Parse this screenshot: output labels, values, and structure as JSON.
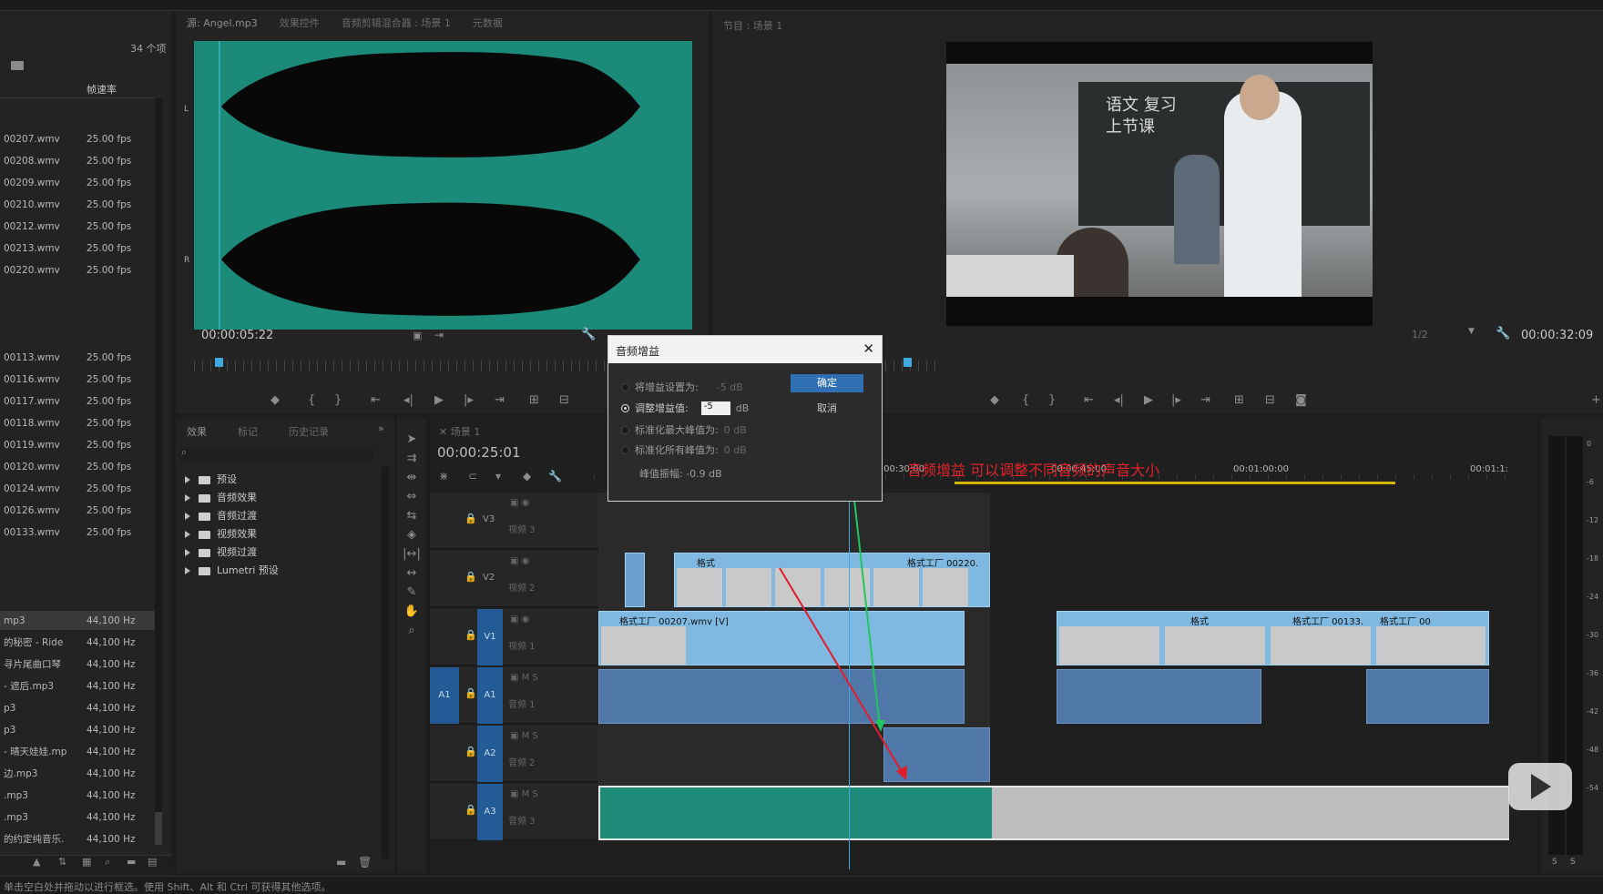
{
  "project": {
    "count": "34 个项",
    "col_header": "帧速率",
    "video_rows": [
      {
        "name": "00207.wmv",
        "rate": "25.00 fps"
      },
      {
        "name": "00208.wmv",
        "rate": "25.00 fps"
      },
      {
        "name": "00209.wmv",
        "rate": "25.00 fps"
      },
      {
        "name": "00210.wmv",
        "rate": "25.00 fps"
      },
      {
        "name": "00212.wmv",
        "rate": "25.00 fps"
      },
      {
        "name": "00213.wmv",
        "rate": "25.00 fps"
      },
      {
        "name": "00220.wmv",
        "rate": "25.00 fps"
      },
      {
        "name": "00113.wmv",
        "rate": "25.00 fps"
      },
      {
        "name": "00116.wmv",
        "rate": "25.00 fps"
      },
      {
        "name": "00117.wmv",
        "rate": "25.00 fps"
      },
      {
        "name": "00118.wmv",
        "rate": "25.00 fps"
      },
      {
        "name": "00119.wmv",
        "rate": "25.00 fps"
      },
      {
        "name": "00120.wmv",
        "rate": "25.00 fps"
      },
      {
        "name": "00124.wmv",
        "rate": "25.00 fps"
      },
      {
        "name": "00126.wmv",
        "rate": "25.00 fps"
      },
      {
        "name": "00133.wmv",
        "rate": "25.00 fps"
      }
    ],
    "audio_rows": [
      {
        "name": "mp3",
        "rate": "44,100 Hz"
      },
      {
        "name": "的秘密 - Ride",
        "rate": "44,100 Hz"
      },
      {
        "name": "寻片尾曲口琴",
        "rate": "44,100 Hz"
      },
      {
        "name": "- 遮后.mp3",
        "rate": "44,100 Hz"
      },
      {
        "name": "p3",
        "rate": "44,100 Hz"
      },
      {
        "name": "p3",
        "rate": "44,100 Hz"
      },
      {
        "name": "- 晴天娃娃.mp",
        "rate": "44,100 Hz"
      },
      {
        "name": "边.mp3",
        "rate": "44,100 Hz"
      },
      {
        "name": ".mp3",
        "rate": "44,100 Hz"
      },
      {
        "name": ".mp3",
        "rate": "44,100 Hz"
      },
      {
        "name": "的约定纯音乐.",
        "rate": "44,100 Hz"
      }
    ]
  },
  "source_monitor": {
    "tabs": [
      "源: Angel.mp3",
      "效果控件",
      "音频剪辑混合器 : 场景 1",
      "元数据"
    ],
    "timecode": "00:00:05:22",
    "channel_labels": [
      "L",
      "R"
    ]
  },
  "program_monitor": {
    "tab": "节目 : 场景 1",
    "timecode": "00:00:32:09",
    "zoom": "1/2",
    "frame_text": "语文 复习上节课"
  },
  "effects": {
    "tabs": [
      "效果",
      "标记",
      "历史记录"
    ],
    "items": [
      "预设",
      "音频效果",
      "音频过渡",
      "视频效果",
      "视频过渡",
      "Lumetri 预设"
    ]
  },
  "timeline": {
    "tab": "场景 1",
    "timecode": "00:00:25:01",
    "ruler": [
      "00:00:30:00",
      "00:00:45:00",
      "00:01:00:00",
      "00:01:1:"
    ],
    "tracks": [
      {
        "id": "V3",
        "name": "视频 3"
      },
      {
        "id": "V2",
        "name": "视频 2"
      },
      {
        "id": "V1",
        "name": "视频 1"
      },
      {
        "id": "A1",
        "name": "音频 1"
      },
      {
        "id": "A2",
        "name": "音频 2"
      },
      {
        "id": "A3",
        "name": "音频 3"
      }
    ],
    "src_v1": "V1",
    "src_a1": "A1",
    "clip_v2": "格式工厂 00220.",
    "clip_v2_short": "格式",
    "clip_v1_main": "格式工厂 00207.wmv [V]",
    "clip_v1_r1": "格式工厂 00133.",
    "clip_v1_r2": "格式工厂 00",
    "clip_v1_r3": "格式",
    "annotation": "音频增益 可以调整不同音频的声音大小"
  },
  "dialog": {
    "title": "音频增益",
    "options": [
      {
        "label": "将增益设置为:",
        "value": "-5 dB"
      },
      {
        "label": "调整增益值:",
        "value": "-5",
        "unit": "dB"
      },
      {
        "label": "标准化最大峰值为:",
        "value": "0 dB"
      },
      {
        "label": "标准化所有峰值为:",
        "value": "0 dB"
      }
    ],
    "peak": "峰值振幅: -0.9 dB",
    "ok": "确定",
    "cancel": "取消"
  },
  "status_bar": "单击空白处并拖动以进行框选。使用 Shift、Alt 和 Ctrl 可获得其他选项。",
  "meter_labels": [
    "0",
    "-6",
    "-12",
    "-18",
    "-24",
    "-30",
    "-36",
    "-42",
    "-48",
    "-54"
  ],
  "meter_solo": [
    "S",
    "S"
  ]
}
